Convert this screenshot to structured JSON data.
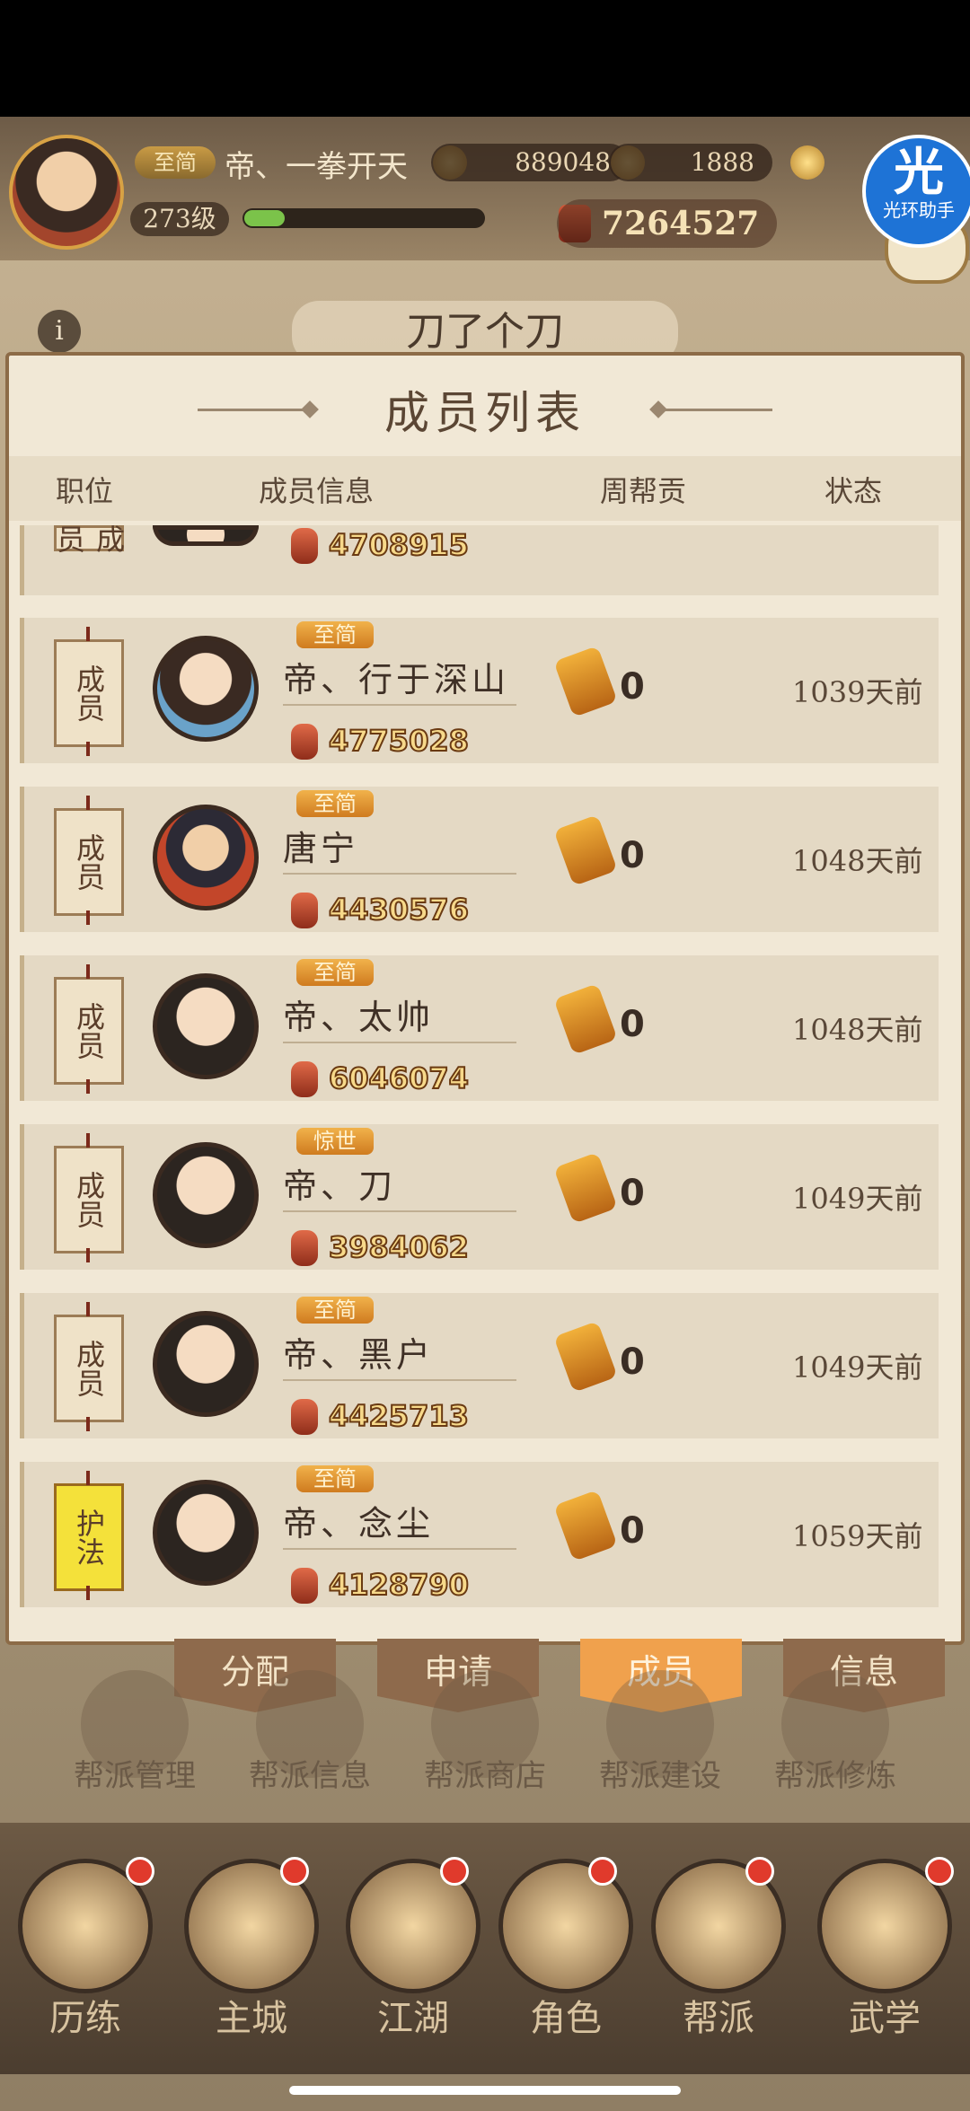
{
  "player": {
    "rank": "至简",
    "name": "帝、一拳开天",
    "coins": "889048",
    "ingots": "1888",
    "level": "273级",
    "level_progress": 0.17,
    "power": "7264527"
  },
  "assistant": {
    "badge": "光",
    "label": "光环助手"
  },
  "guild": {
    "name": "刀了个刀"
  },
  "panel": {
    "title": "成员列表",
    "columns": {
      "position": "职位",
      "info": "成员信息",
      "weekly": "周帮贡",
      "status": "状态"
    }
  },
  "members": [
    {
      "position": "成员",
      "rank": "",
      "name": "",
      "power": "4708915",
      "contrib": "",
      "status": ""
    },
    {
      "position": "成员",
      "rank": "至简",
      "name": "帝、行于深山",
      "power": "4775028",
      "contrib": "0",
      "status": "1039天前"
    },
    {
      "position": "成员",
      "rank": "至简",
      "name": "唐宁",
      "power": "4430576",
      "contrib": "0",
      "status": "1048天前"
    },
    {
      "position": "成员",
      "rank": "至简",
      "name": "帝、太帅",
      "power": "6046074",
      "contrib": "0",
      "status": "1048天前"
    },
    {
      "position": "成员",
      "rank": "惊世",
      "name": "帝、刀",
      "power": "3984062",
      "contrib": "0",
      "status": "1049天前"
    },
    {
      "position": "成员",
      "rank": "至简",
      "name": "帝、黑户",
      "power": "4425713",
      "contrib": "0",
      "status": "1049天前"
    },
    {
      "position": "护法",
      "rank": "至简",
      "name": "帝、念尘",
      "power": "4128790",
      "contrib": "0",
      "status": "1059天前"
    }
  ],
  "subtabs": [
    "分配",
    "申请",
    "成员",
    "信息"
  ],
  "active_subtab": "成员",
  "functions": [
    "帮派管理",
    "帮派信息",
    "帮派商店",
    "帮派建设",
    "帮派修炼"
  ],
  "nav": [
    "历练",
    "主城",
    "江湖",
    "角色",
    "帮派",
    "武学"
  ],
  "colors": {
    "accent": "#f0a14d",
    "badge": "#cf7b1f",
    "panel": "#f1e8d6"
  }
}
